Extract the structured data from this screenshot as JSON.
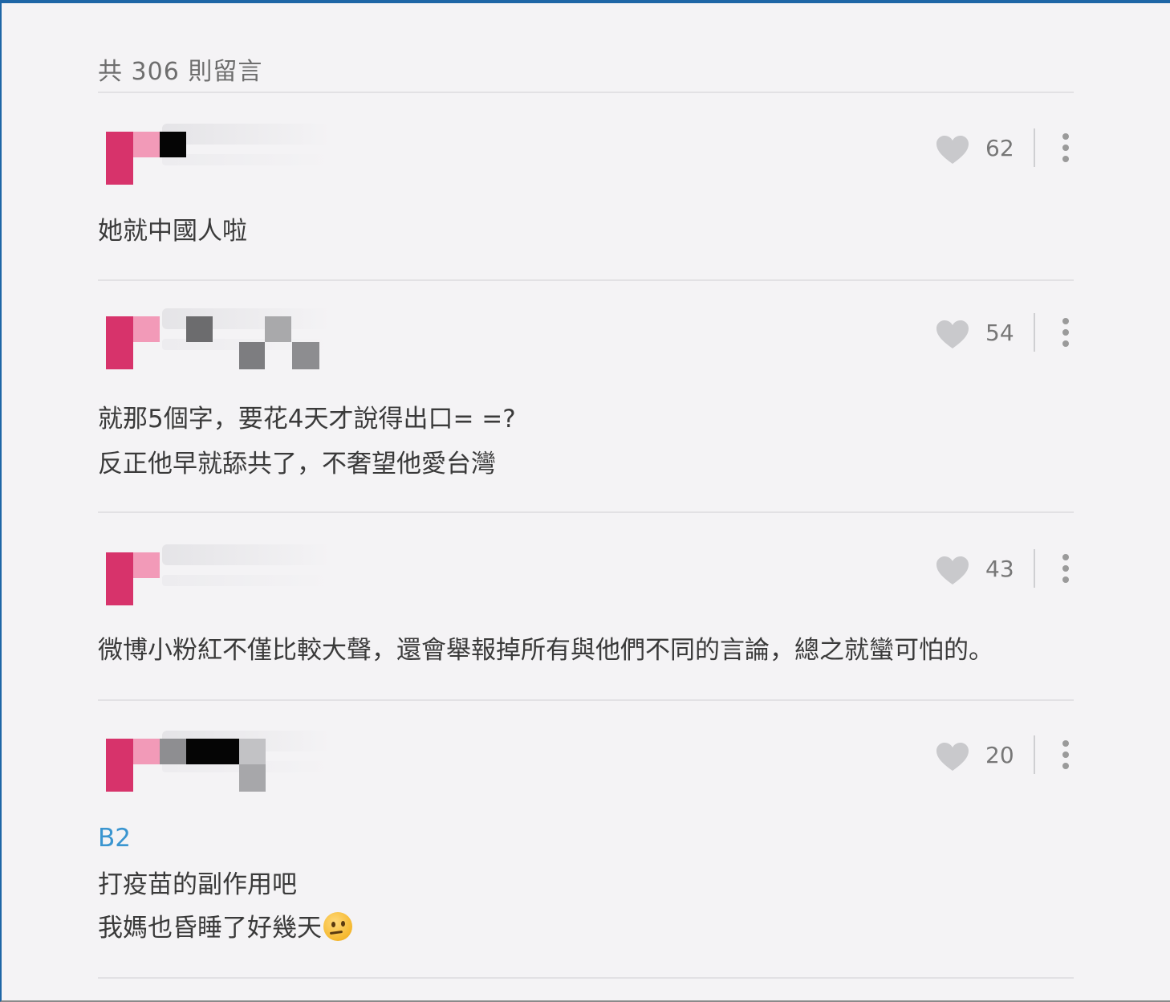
{
  "comments_header": "共 306 則留言",
  "comments": [
    {
      "likes": "62",
      "lines": [
        "她就中國人啦"
      ]
    },
    {
      "likes": "54",
      "lines": [
        "就那5個字，要花4天才說得出口= =?",
        "反正他早就舔共了，不奢望他愛台灣"
      ]
    },
    {
      "likes": "43",
      "lines": [
        "微博小粉紅不僅比較大聲，還會舉報掉所有與他們不同的言論，總之就蠻可怕的。"
      ]
    },
    {
      "likes": "20",
      "reply_to": "B2",
      "lines": [
        "打疫苗的副作用吧",
        "我媽也昏睡了好幾天"
      ]
    }
  ],
  "colors": {
    "accent_border": "#1e66a6",
    "reply_tag": "#3a95d0",
    "avatar_pink": "#d7336b",
    "avatar_light_pink": "#f29ab8"
  },
  "icons": {
    "like": "heart-icon",
    "menu": "more-vertical-icon"
  }
}
